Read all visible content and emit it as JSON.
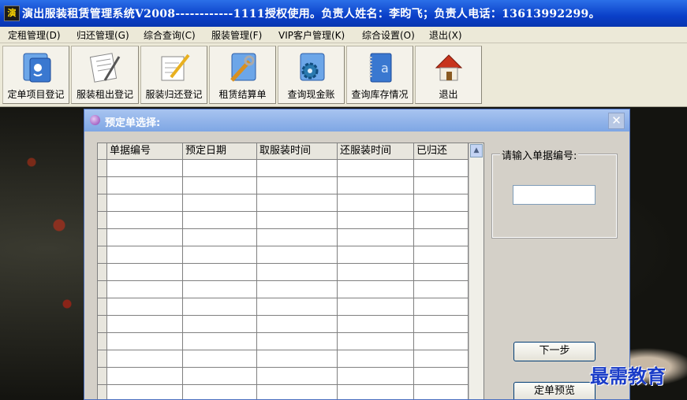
{
  "app": {
    "icon_glyph": "演",
    "title": "演出服装租赁管理系统V2008------------1111授权使用。负责人姓名：李昀飞；负责人电话：13613992299。"
  },
  "menu": [
    "定租管理(D)",
    "归还管理(G)",
    "综合查询(C)",
    "服装管理(F)",
    "VIP客户管理(K)",
    "综合设置(O)",
    "退出(X)"
  ],
  "toolbar": [
    {
      "label": "定单项目登记",
      "icon": "finder-icon"
    },
    {
      "label": "服装租出登记",
      "icon": "document-pen-icon"
    },
    {
      "label": "服装归还登记",
      "icon": "pencil-document-icon"
    },
    {
      "label": "租赁结算单",
      "icon": "tools-icon"
    },
    {
      "label": "查询现金账",
      "icon": "gear-folder-icon"
    },
    {
      "label": "查询库存情况",
      "icon": "address-book-icon"
    },
    {
      "label": "退出",
      "icon": "home-icon"
    }
  ],
  "dialog": {
    "title": "预定单选择:",
    "close_glyph": "✕",
    "grid": {
      "columns": [
        "单据编号",
        "预定日期",
        "取服装时间",
        "还服装时间",
        "已归还"
      ],
      "rows": [
        [
          "",
          "",
          "",
          "",
          ""
        ],
        [
          "",
          "",
          "",
          "",
          ""
        ],
        [
          "",
          "",
          "",
          "",
          ""
        ],
        [
          "",
          "",
          "",
          "",
          ""
        ],
        [
          "",
          "",
          "",
          "",
          ""
        ],
        [
          "",
          "",
          "",
          "",
          ""
        ],
        [
          "",
          "",
          "",
          "",
          ""
        ],
        [
          "",
          "",
          "",
          "",
          ""
        ],
        [
          "",
          "",
          "",
          "",
          ""
        ],
        [
          "",
          "",
          "",
          "",
          ""
        ],
        [
          "",
          "",
          "",
          "",
          ""
        ],
        [
          "",
          "",
          "",
          "",
          ""
        ],
        [
          "",
          "",
          "",
          "",
          ""
        ],
        [
          "",
          "",
          "",
          "",
          ""
        ]
      ]
    },
    "search": {
      "label": "请输入单据编号:",
      "value": ""
    },
    "next_button": "下一步",
    "preview_button": "定单预览"
  },
  "watermark": "最需教育",
  "colors": {
    "titlebar": "#0a3fc8",
    "dialog_titlebar": "#7ea6e4",
    "watermark": "#1a3cc8"
  }
}
